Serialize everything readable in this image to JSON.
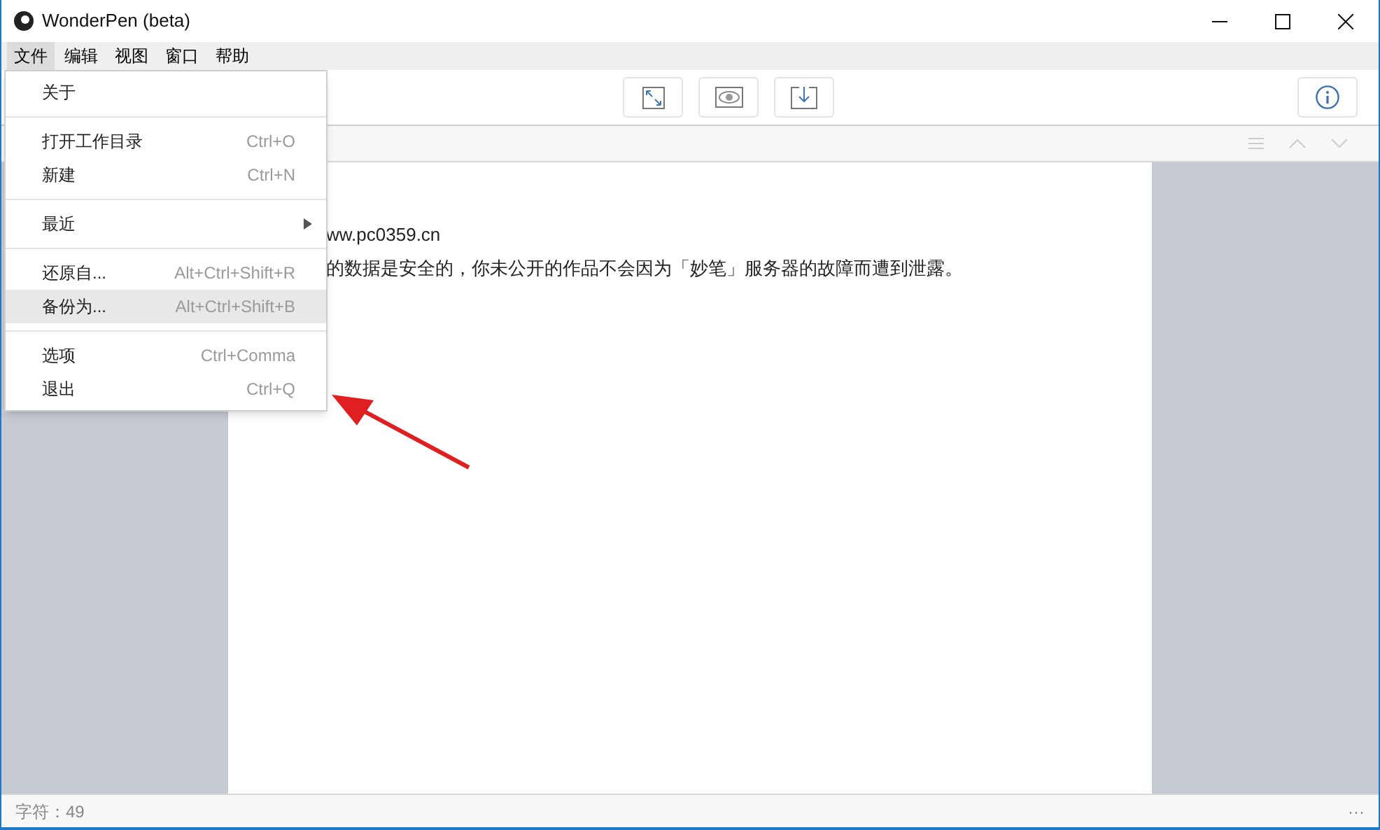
{
  "window": {
    "title": "WonderPen (beta)"
  },
  "menu_bar": [
    {
      "label": "文件",
      "selected": true
    },
    {
      "label": "编辑",
      "selected": false
    },
    {
      "label": "视图",
      "selected": false
    },
    {
      "label": "窗口",
      "selected": false
    },
    {
      "label": "帮助",
      "selected": false
    }
  ],
  "dropdown": [
    {
      "kind": "item",
      "label": "关于",
      "selected": false
    },
    {
      "kind": "separator"
    },
    {
      "kind": "item",
      "label": "打开工作目录",
      "shortcut": "Ctrl+O",
      "selected": false
    },
    {
      "kind": "item",
      "label": "新建",
      "shortcut": "Ctrl+N",
      "selected": false
    },
    {
      "kind": "separator"
    },
    {
      "kind": "submenu",
      "label": "最近",
      "selected": false
    },
    {
      "kind": "separator"
    },
    {
      "kind": "item",
      "label": "还原自...",
      "shortcut": "Alt+Ctrl+Shift+R",
      "selected": false
    },
    {
      "kind": "item",
      "label": "备份为...",
      "shortcut": "Alt+Ctrl+Shift+B",
      "selected": true
    },
    {
      "kind": "separator"
    },
    {
      "kind": "item",
      "label": "选项",
      "shortcut": "Ctrl+Comma",
      "selected": false
    },
    {
      "kind": "item",
      "label": "退出",
      "shortcut": "Ctrl+Q",
      "selected": false
    }
  ],
  "document": {
    "lines": [
      "ww.pc0359.cn",
      "的数据是安全的，你未公开的作品不会因为「妙笔」服务器的故障而遭到泄露。"
    ]
  },
  "status_bar": {
    "char_count": "字符：49",
    "more": "···"
  }
}
